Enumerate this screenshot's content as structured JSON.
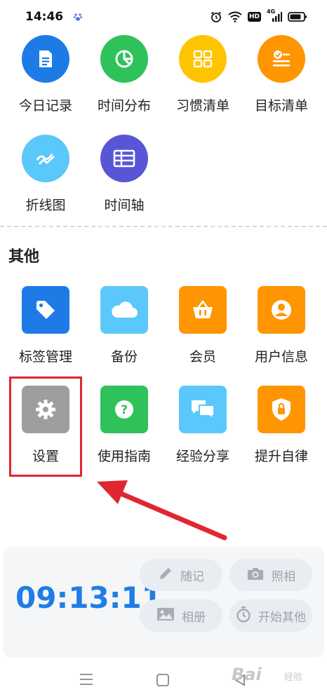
{
  "status_bar": {
    "time": "14:46",
    "hd_badge": "HD",
    "network_label": "4G"
  },
  "top_grid": {
    "items": [
      {
        "label": "今日记录",
        "icon": "document-icon",
        "color": "#1e7be6"
      },
      {
        "label": "时间分布",
        "icon": "pie-chart-icon",
        "color": "#2fc25b"
      },
      {
        "label": "习惯清单",
        "icon": "grid-list-icon",
        "color": "#ffc400"
      },
      {
        "label": "目标清单",
        "icon": "checklist-icon",
        "color": "#ff9500"
      },
      {
        "label": "折线图",
        "icon": "line-chart-icon",
        "color": "#5ac8fa"
      },
      {
        "label": "时间轴",
        "icon": "table-icon",
        "color": "#5856d6"
      }
    ]
  },
  "other_section": {
    "title": "其他",
    "items": [
      {
        "label": "标签管理",
        "icon": "tag-icon",
        "color": "#1e7be6"
      },
      {
        "label": "备份",
        "icon": "cloud-icon",
        "color": "#5ac8fa"
      },
      {
        "label": "会员",
        "icon": "basket-icon",
        "color": "#ff9500"
      },
      {
        "label": "用户信息",
        "icon": "user-icon",
        "color": "#ff9500"
      },
      {
        "label": "设置",
        "icon": "gear-icon",
        "color": "#9e9e9e"
      },
      {
        "label": "使用指南",
        "icon": "help-icon",
        "color": "#2fc25b"
      },
      {
        "label": "经验分享",
        "icon": "chat-icon",
        "color": "#5ac8fa"
      },
      {
        "label": "提升自律",
        "icon": "shield-lock-icon",
        "color": "#ff9500"
      }
    ]
  },
  "timer": {
    "value": "09:13:11",
    "color": "#1e7de6"
  },
  "actions": [
    {
      "label": "随记",
      "icon": "pencil-icon"
    },
    {
      "label": "照相",
      "icon": "camera-icon"
    },
    {
      "label": "相册",
      "icon": "image-icon"
    },
    {
      "label": "开始其他",
      "icon": "stopwatch-icon"
    }
  ],
  "watermark": {
    "brand": "Bai",
    "sub": "经验"
  }
}
